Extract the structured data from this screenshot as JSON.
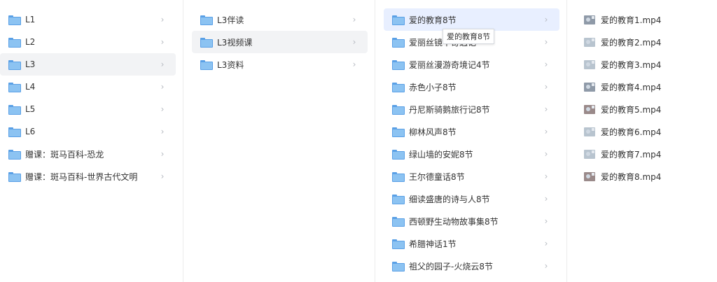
{
  "columns": {
    "col1": {
      "items": [
        {
          "label": "L1"
        },
        {
          "label": "L2"
        },
        {
          "label": "L3"
        },
        {
          "label": "L4"
        },
        {
          "label": "L5"
        },
        {
          "label": "L6"
        },
        {
          "label": "赠课：斑马百科-恐龙"
        },
        {
          "label": "赠课：斑马百科-世界古代文明"
        }
      ]
    },
    "col2": {
      "items": [
        {
          "label": "L3伴读"
        },
        {
          "label": "L3视频课"
        },
        {
          "label": "L3资料"
        }
      ]
    },
    "col3": {
      "items": [
        {
          "label": "爱的教育8节"
        },
        {
          "label": "爱丽丝镜中奇遇记"
        },
        {
          "label": "爱丽丝漫游奇境记4节"
        },
        {
          "label": "赤色小子8节"
        },
        {
          "label": "丹尼斯骑鹅旅行记8节"
        },
        {
          "label": "柳林风声8节"
        },
        {
          "label": "绿山墙的安妮8节"
        },
        {
          "label": "王尔德童话8节"
        },
        {
          "label": "细读盛唐的诗与人8节"
        },
        {
          "label": "西顿野生动物故事集8节"
        },
        {
          "label": "希腊神话1节"
        },
        {
          "label": "祖父的园子-火烧云8节"
        }
      ]
    },
    "col4": {
      "items": [
        {
          "label": "爱的教育1.mp4"
        },
        {
          "label": "爱的教育2.mp4"
        },
        {
          "label": "爱的教育3.mp4"
        },
        {
          "label": "爱的教育4.mp4"
        },
        {
          "label": "爱的教育5.mp4"
        },
        {
          "label": "爱的教育6.mp4"
        },
        {
          "label": "爱的教育7.mp4"
        },
        {
          "label": "爱的教育8.mp4"
        }
      ]
    }
  },
  "chevron": "›",
  "tooltip": {
    "text": "爱的教育8节"
  }
}
